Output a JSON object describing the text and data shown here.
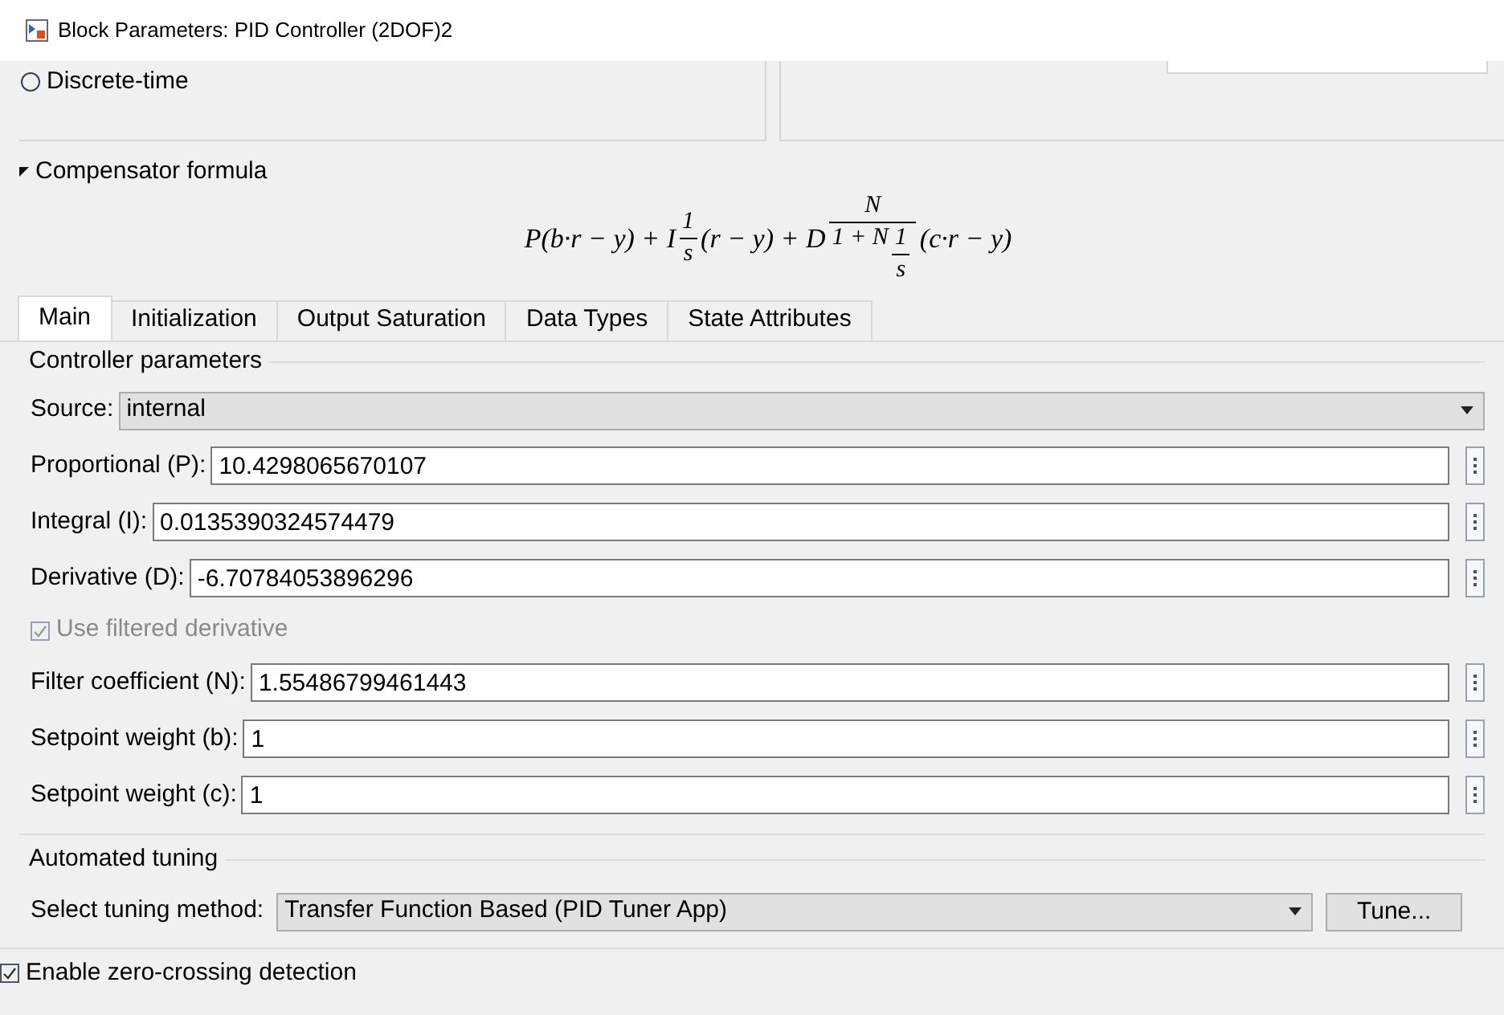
{
  "window": {
    "title": "Block Parameters: PID Controller (2DOF)2"
  },
  "time_domain": {
    "options": [
      {
        "label": "Discrete-time",
        "selected": false
      }
    ]
  },
  "compensator": {
    "label": "Compensator formula",
    "expanded": true,
    "formula": [
      {
        "kind": "text",
        "text": "P(b·r − y) + I"
      },
      {
        "kind": "frac",
        "num": [
          {
            "kind": "text",
            "text": "1"
          }
        ],
        "den": [
          {
            "kind": "text",
            "text": "s"
          }
        ]
      },
      {
        "kind": "text",
        "text": "(r − y) + D"
      },
      {
        "kind": "frac",
        "num": [
          {
            "kind": "text",
            "text": "N"
          }
        ],
        "den": [
          {
            "kind": "text",
            "text": "1 + N"
          },
          {
            "kind": "frac",
            "num": [
              {
                "kind": "text",
                "text": "1"
              }
            ],
            "den": [
              {
                "kind": "text",
                "text": "s"
              }
            ]
          }
        ]
      },
      {
        "kind": "text",
        "text": "(c·r − y)"
      }
    ]
  },
  "tabs": [
    {
      "label": "Main",
      "selected": true
    },
    {
      "label": "Initialization",
      "selected": false
    },
    {
      "label": "Output Saturation",
      "selected": false
    },
    {
      "label": "Data Types",
      "selected": false
    },
    {
      "label": "State Attributes",
      "selected": false
    }
  ],
  "controller_parameters": {
    "title": "Controller parameters",
    "rows": [
      {
        "kind": "dropdown",
        "label": "Source:",
        "value": "internal"
      },
      {
        "kind": "field",
        "label": "Proportional (P):",
        "value": "10.4298065670107"
      },
      {
        "kind": "field",
        "label": "Integral (I):",
        "value": "0.0135390324574479"
      },
      {
        "kind": "field",
        "label": "Derivative (D):",
        "value": "-6.70784053896296"
      },
      {
        "kind": "checkbox",
        "label": "Use filtered derivative",
        "checked": true,
        "disabled": true
      },
      {
        "kind": "field",
        "label": "Filter coefficient (N):",
        "value": "1.55486799461443"
      },
      {
        "kind": "field",
        "label": "Setpoint weight (b):",
        "value": "1"
      },
      {
        "kind": "field",
        "label": "Setpoint weight (c):",
        "value": "1"
      }
    ]
  },
  "automated_tuning": {
    "title": "Automated tuning",
    "label": "Select tuning method:",
    "value": "Transfer Function Based (PID Tuner App)",
    "button": "Tune..."
  },
  "zero_crossing": {
    "label": "Enable zero-crossing detection",
    "checked": true
  }
}
